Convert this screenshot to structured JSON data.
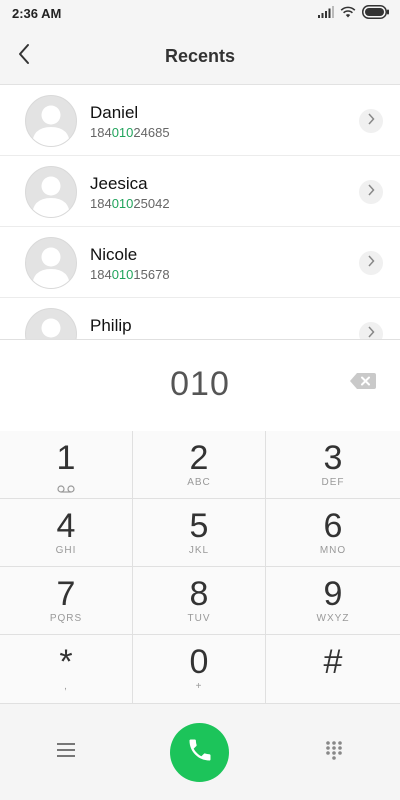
{
  "status_bar": {
    "time": "2:36 AM"
  },
  "header": {
    "title": "Recents"
  },
  "contacts": [
    {
      "name": "Daniel",
      "number_prefix": "184",
      "number_match": "010",
      "number_suffix": "24685"
    },
    {
      "name": "Jeesica",
      "number_prefix": "184",
      "number_match": "010",
      "number_suffix": "25042"
    },
    {
      "name": "Nicole",
      "number_prefix": "184",
      "number_match": "010",
      "number_suffix": "15678"
    },
    {
      "name": "Philip",
      "number_prefix": "",
      "number_match": "",
      "number_suffix": ""
    }
  ],
  "dialer": {
    "input": "010"
  },
  "keypad": [
    {
      "digit": "1",
      "letters": ""
    },
    {
      "digit": "2",
      "letters": "ABC"
    },
    {
      "digit": "3",
      "letters": "DEF"
    },
    {
      "digit": "4",
      "letters": "GHI"
    },
    {
      "digit": "5",
      "letters": "JKL"
    },
    {
      "digit": "6",
      "letters": "MNO"
    },
    {
      "digit": "7",
      "letters": "PQRS"
    },
    {
      "digit": "8",
      "letters": "TUV"
    },
    {
      "digit": "9",
      "letters": "WXYZ"
    },
    {
      "digit": "*",
      "letters": ","
    },
    {
      "digit": "0",
      "letters": "+"
    },
    {
      "digit": "#",
      "letters": ""
    }
  ],
  "icons": {
    "back": "back-arrow-icon",
    "backspace": "backspace-icon",
    "voicemail": "voicemail-icon",
    "menu": "menu-icon",
    "call": "phone-icon",
    "dialpad": "dialpad-icon"
  },
  "colors": {
    "accent": "#21a45c",
    "call_button": "#1cc45a",
    "background": "#f5f5f5"
  }
}
